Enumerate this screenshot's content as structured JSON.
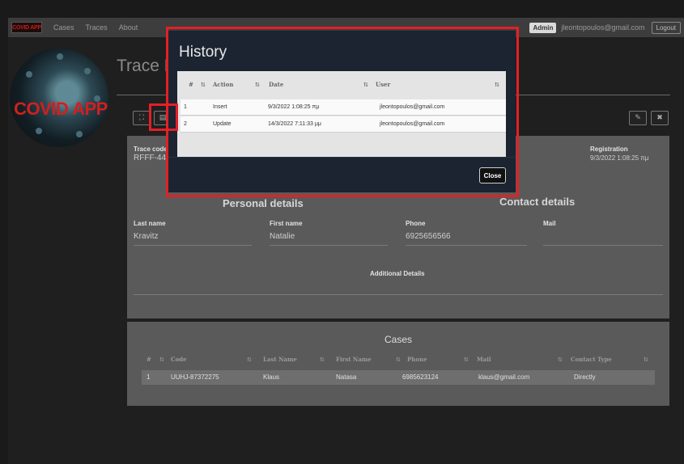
{
  "navbar": {
    "brand": "COVID APP",
    "links": [
      "Cases",
      "Traces",
      "About"
    ],
    "admin_badge": "Admin",
    "user_email": "jleontopoulos@gmail.com",
    "logout_label": "Logout"
  },
  "logo_text": "COVID APP",
  "page": {
    "title": "Trace D"
  },
  "trace": {
    "code_label": "Trace code",
    "code_value": "RFFF-44",
    "registration_label": "Registration",
    "registration_value": "9/3/2022 1:08:25 πμ"
  },
  "personal_details": {
    "heading": "Personal details",
    "last_name_label": "Last name",
    "last_name_value": "Kravitz",
    "first_name_label": "First name",
    "first_name_value": "Natalie"
  },
  "contact_details": {
    "heading": "Contact details",
    "phone_label": "Phone",
    "phone_value": "6925656566",
    "mail_label": "Mail",
    "mail_value": ""
  },
  "additional_details_label": "Additional Details",
  "cases": {
    "title": "Cases",
    "columns": [
      "#",
      "Code",
      "Last Name",
      "First Name",
      "Phone",
      "Mail",
      "Contact Type"
    ],
    "rows": [
      {
        "num": "1",
        "code": "UUHJ-87372275",
        "last_name": "Klaus",
        "first_name": "Natasa",
        "phone": "6985623124",
        "mail": "klaus@gmail.com",
        "contact_type": "Directly"
      }
    ]
  },
  "history_modal": {
    "title": "History",
    "columns": [
      "#",
      "Action",
      "Date",
      "User"
    ],
    "rows": [
      {
        "num": "1",
        "action": "Insert",
        "date": "9/3/2022 1:08:25 πμ",
        "user": "jleontopoulos@gmail.com"
      },
      {
        "num": "2",
        "action": "Update",
        "date": "14/3/2022 7:11:33 μμ",
        "user": "jleontopoulos@gmail.com"
      }
    ],
    "close_label": "Close"
  },
  "icons": {
    "expand": "expand-icon",
    "history": "history-icon",
    "edit": "pencil-icon",
    "delete": "close-icon",
    "sort": "sort-icon"
  },
  "sort_glyph": "⇅",
  "highlight_color": "#e41f26"
}
